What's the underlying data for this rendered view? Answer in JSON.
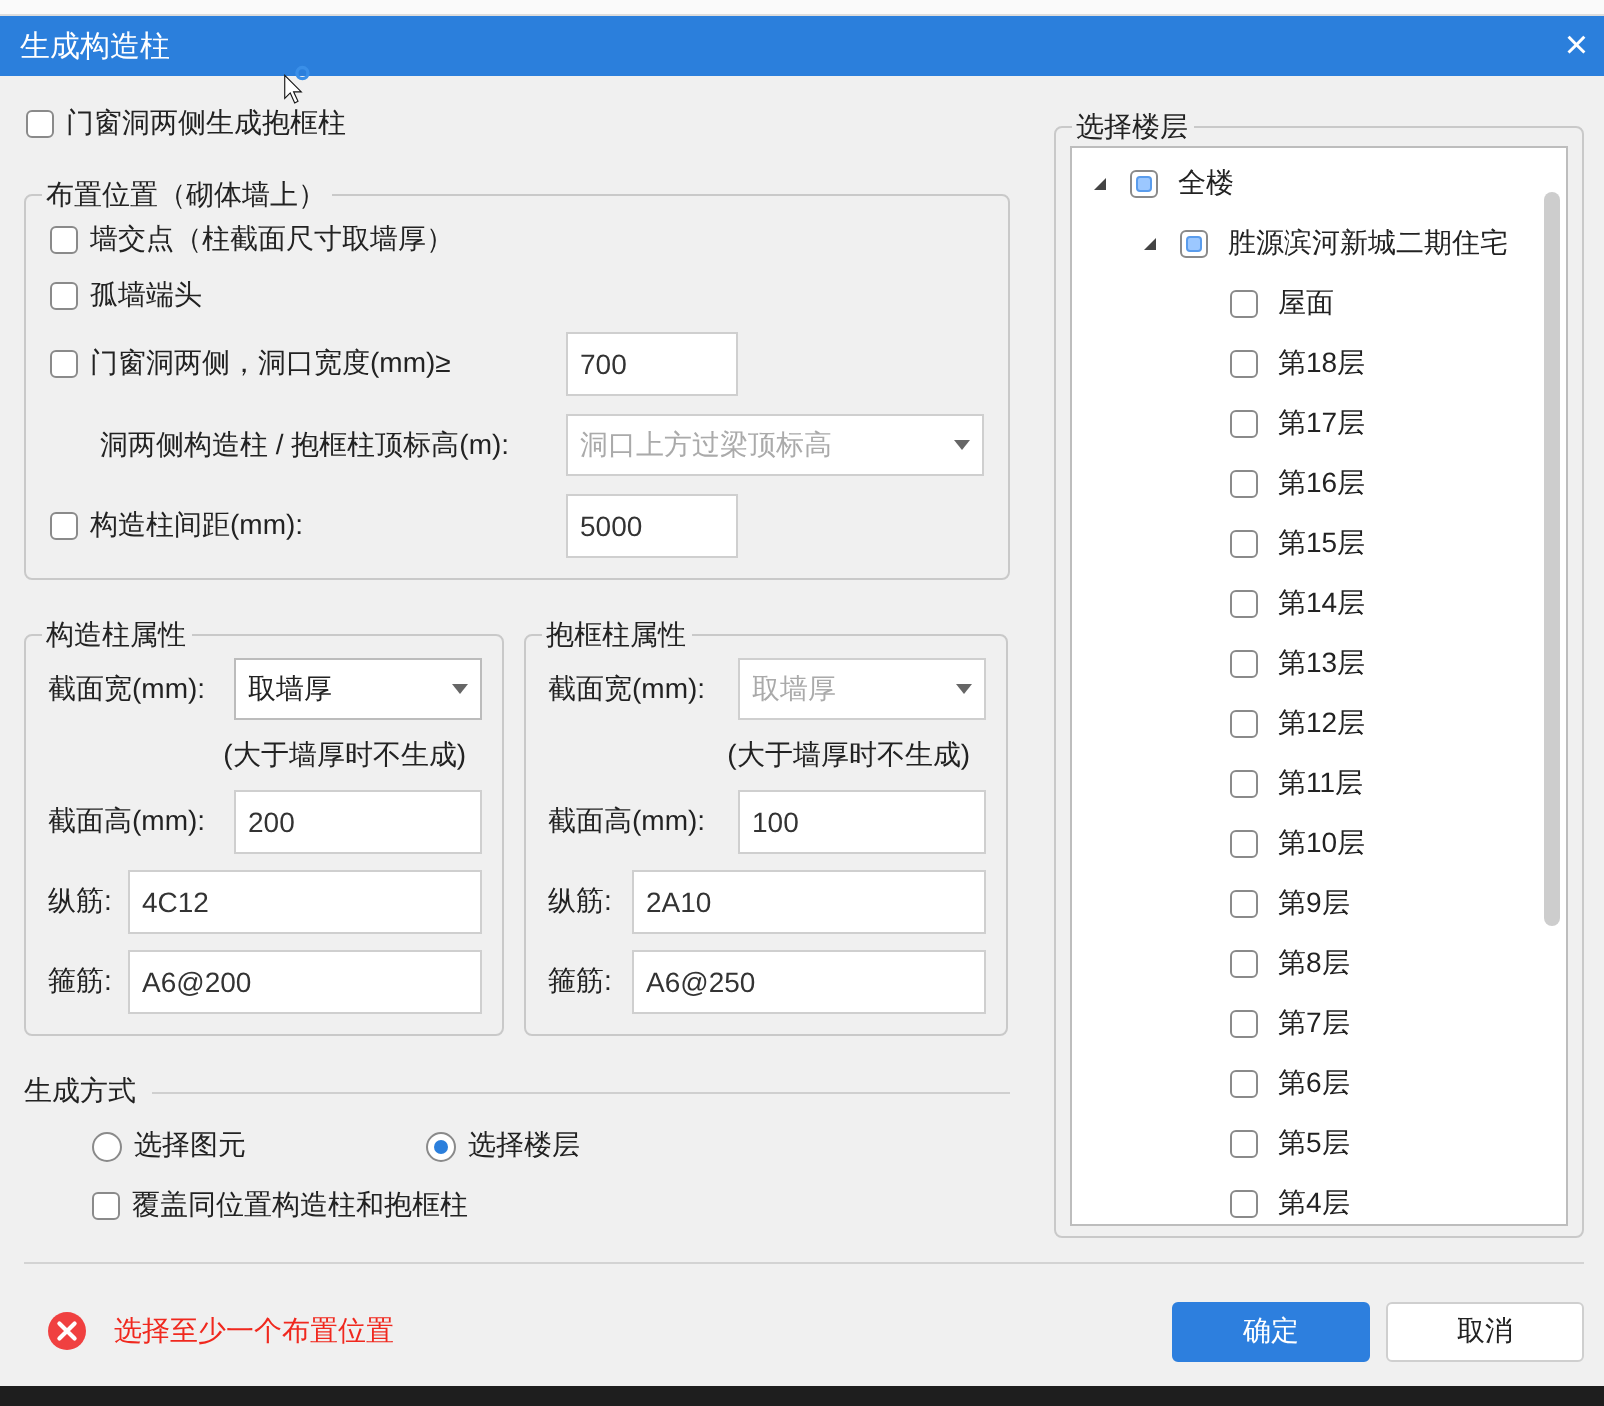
{
  "title_bar": {
    "title": "生成构造柱",
    "close": "×"
  },
  "top_option": {
    "label": "门窗洞两侧生成抱框柱",
    "checked": false
  },
  "placement": {
    "title": "布置位置（砌体墙上）",
    "options": [
      {
        "kind": "check",
        "label": "墙交点（柱截面尺寸取墙厚）",
        "checked": false
      },
      {
        "kind": "check",
        "label": "孤墙端头",
        "checked": false
      },
      {
        "kind": "check_input",
        "label": "门窗洞两侧，洞口宽度(mm)≥",
        "checked": false,
        "value": "700"
      },
      {
        "kind": "select",
        "label": "洞两侧构造柱 / 抱框柱顶标高(m):",
        "value": "洞口上方过梁顶标高",
        "disabled": true
      },
      {
        "kind": "check_input",
        "label": "构造柱间距(mm):",
        "checked": false,
        "value": "5000"
      }
    ]
  },
  "property_groups": [
    {
      "title": "构造柱属性",
      "width_label": "截面宽(mm):",
      "width_value": "取墙厚",
      "width_disabled": false,
      "width_note": "(大于墙厚时不生成)",
      "height_label": "截面高(mm):",
      "height_value": "200",
      "long_bar_label": "纵筋:",
      "long_bar_value": "4C12",
      "stirrup_label": "箍筋:",
      "stirrup_value": "A6@200"
    },
    {
      "title": "抱框柱属性",
      "width_label": "截面宽(mm):",
      "width_value": "取墙厚",
      "width_disabled": true,
      "width_note": "(大于墙厚时不生成)",
      "height_label": "截面高(mm):",
      "height_value": "100",
      "long_bar_label": "纵筋:",
      "long_bar_value": "2A10",
      "stirrup_label": "箍筋:",
      "stirrup_value": "A6@250"
    }
  ],
  "generate_mode": {
    "title": "生成方式",
    "modes": [
      {
        "label": "选择图元",
        "selected": false
      },
      {
        "label": "选择楼层",
        "selected": true
      }
    ],
    "overwrite": {
      "label": "覆盖同位置构造柱和抱框柱",
      "checked": false
    }
  },
  "floors": {
    "title": "选择楼层",
    "tree": [
      {
        "label": "全楼",
        "partial": true,
        "expanded": true,
        "children": [
          {
            "label": "胜源滨河新城二期住宅",
            "partial": true,
            "expanded": true,
            "children": [
              {
                "label": "屋面",
                "checked": false
              },
              {
                "label": "第18层",
                "checked": false
              },
              {
                "label": "第17层",
                "checked": false
              },
              {
                "label": "第16层",
                "checked": false
              },
              {
                "label": "第15层",
                "checked": false
              },
              {
                "label": "第14层",
                "checked": false
              },
              {
                "label": "第13层",
                "checked": false
              },
              {
                "label": "第12层",
                "checked": false
              },
              {
                "label": "第11层",
                "checked": false
              },
              {
                "label": "第10层",
                "checked": false
              },
              {
                "label": "第9层",
                "checked": false
              },
              {
                "label": "第8层",
                "checked": false
              },
              {
                "label": "第7层",
                "checked": false
              },
              {
                "label": "第6层",
                "checked": false
              },
              {
                "label": "第5层",
                "checked": false
              },
              {
                "label": "第4层",
                "checked": false
              }
            ]
          }
        ]
      }
    ]
  },
  "error": "选择至少一个布置位置",
  "buttons": [
    {
      "label": "确定",
      "kind": "primary"
    },
    {
      "label": "取消",
      "kind": "secondary"
    }
  ]
}
